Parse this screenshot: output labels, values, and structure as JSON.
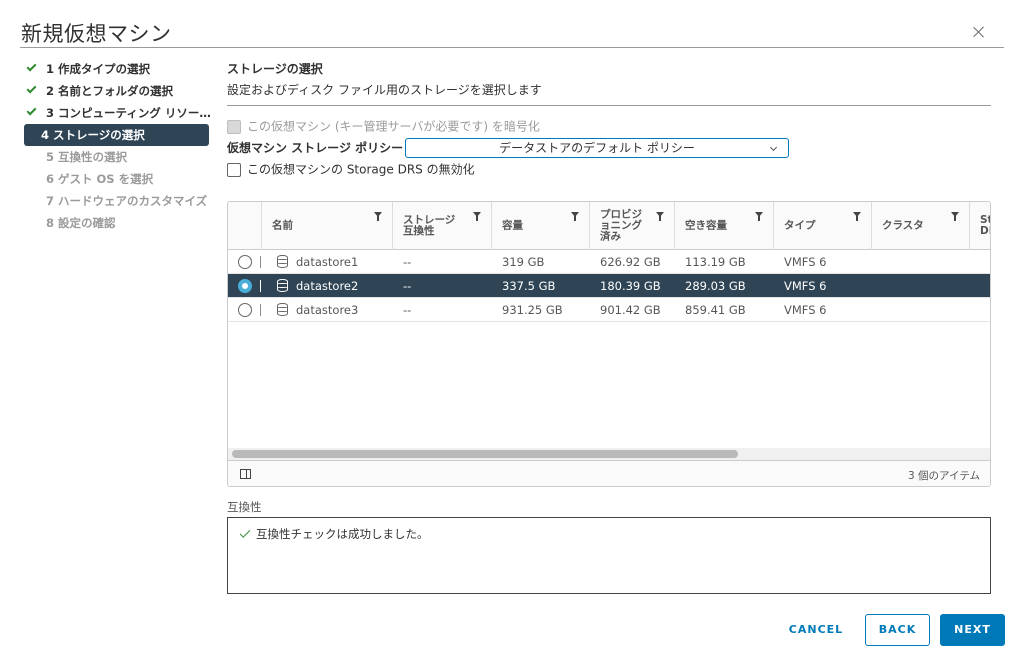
{
  "dialog": {
    "title": "新規仮想マシン"
  },
  "steps": [
    {
      "label": "1 作成タイプの選択",
      "state": "done"
    },
    {
      "label": "2 名前とフォルダの選択",
      "state": "done"
    },
    {
      "label": "3 コンピューティング リソー...",
      "state": "done"
    },
    {
      "label": "4 ストレージの選択",
      "state": "active"
    },
    {
      "label": "5 互換性の選択",
      "state": "pending"
    },
    {
      "label": "6 ゲスト OS を選択",
      "state": "pending"
    },
    {
      "label": "7 ハードウェアのカスタマイズ",
      "state": "pending"
    },
    {
      "label": "8 設定の確認",
      "state": "pending"
    }
  ],
  "content": {
    "title": "ストレージの選択",
    "description": "設定およびディスク ファイル用のストレージを選択します",
    "encrypt_label": "この仮想マシン (キー管理サーバが必要です) を暗号化",
    "policy_label": "仮想マシン ストレージ ポリシー",
    "policy_value": "データストアのデフォルト ポリシー",
    "drs_label": "この仮想マシンの Storage DRS の無効化"
  },
  "grid": {
    "columns": [
      "名前",
      "ストレージ\n互換性",
      "容量",
      "プロビジ\nョニング\n済み",
      "空き容量",
      "タイプ",
      "クラスタ",
      "St\nDR"
    ],
    "rows": [
      {
        "name": "datastore1",
        "compat": "--",
        "capacity": "319 GB",
        "provisioned": "626.92 GB",
        "free": "113.19 GB",
        "type": "VMFS 6",
        "cluster": "",
        "selected": false
      },
      {
        "name": "datastore2",
        "compat": "--",
        "capacity": "337.5 GB",
        "provisioned": "180.39 GB",
        "free": "289.03 GB",
        "type": "VMFS 6",
        "cluster": "",
        "selected": true
      },
      {
        "name": "datastore3",
        "compat": "--",
        "capacity": "931.25 GB",
        "provisioned": "901.42 GB",
        "free": "859.41 GB",
        "type": "VMFS 6",
        "cluster": "",
        "selected": false
      }
    ],
    "item_count": "3 個のアイテム"
  },
  "compatibility": {
    "title": "互換性",
    "message": "互換性チェックは成功しました。"
  },
  "buttons": {
    "cancel": "CANCEL",
    "back": "BACK",
    "next": "NEXT"
  },
  "colors": {
    "accent": "#0079b8",
    "selected_row": "#2f4555",
    "success": "#2f8a2f"
  }
}
